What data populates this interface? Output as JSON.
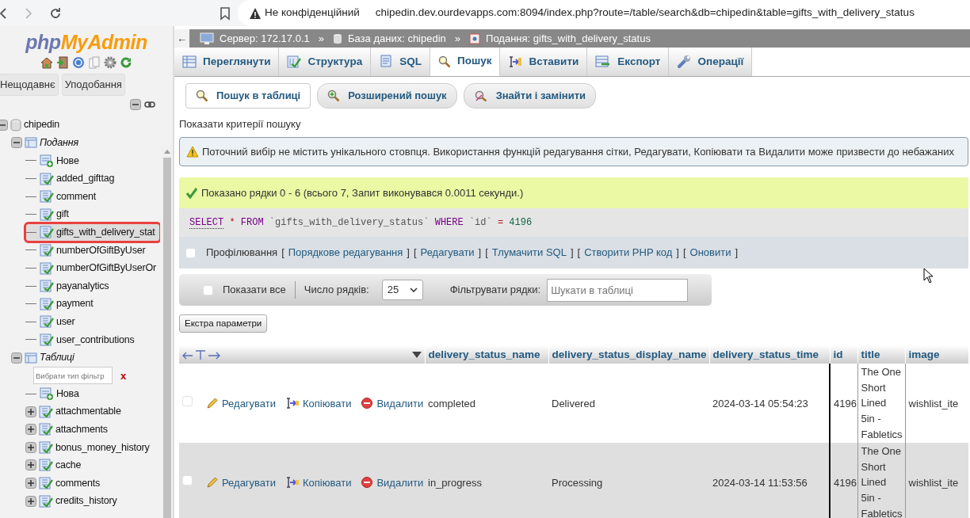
{
  "browser": {
    "warning": "Не конфіденційний",
    "url": "chipedin.dev.ourdevapps.com:8094/index.php?route=/table/search&db=chipedin&table=gifts_with_delivery_status"
  },
  "sidebar": {
    "logo": {
      "prefix": "php",
      "suffix": "MyAdmin"
    },
    "buttons": [
      "Нещодавнє",
      "Уподобання"
    ],
    "tree": [
      {
        "label": "chipedin",
        "kind": "database",
        "expanded": true,
        "children": [
          {
            "label": "Подання",
            "kind": "group",
            "expanded": true,
            "children": [
              {
                "label": "Нове",
                "kind": "new",
                "selected": false
              },
              {
                "label": "added_gifttag",
                "kind": "view",
                "selected": false
              },
              {
                "label": "comment",
                "kind": "view",
                "selected": false
              },
              {
                "label": "gift",
                "kind": "view",
                "selected": false
              },
              {
                "label": "gifts_with_delivery_stat",
                "kind": "view",
                "selected": true
              },
              {
                "label": "numberOfGiftByUser",
                "kind": "view",
                "selected": false
              },
              {
                "label": "numberOfGiftByUserOr",
                "kind": "view",
                "selected": false
              },
              {
                "label": "payanalytics",
                "kind": "view",
                "selected": false
              },
              {
                "label": "payment",
                "kind": "view",
                "selected": false
              },
              {
                "label": "user",
                "kind": "view",
                "selected": false
              },
              {
                "label": "user_contributions",
                "kind": "view",
                "selected": false
              }
            ]
          },
          {
            "label": "Таблиці",
            "kind": "group",
            "expanded": true,
            "filter": {
              "placeholder": "Вибрати тип фільтр",
              "clear": "x"
            },
            "children": [
              {
                "label": "Нова",
                "kind": "new",
                "selected": false
              },
              {
                "label": "attachmentable",
                "kind": "table",
                "expanded": false,
                "selected": false
              },
              {
                "label": "attachments",
                "kind": "table",
                "expanded": false,
                "selected": false
              },
              {
                "label": "bonus_money_history",
                "kind": "table",
                "expanded": false,
                "selected": false
              },
              {
                "label": "cache",
                "kind": "table",
                "expanded": false,
                "selected": false
              },
              {
                "label": "comments",
                "kind": "table",
                "expanded": false,
                "selected": false
              },
              {
                "label": "credits_history",
                "kind": "table",
                "expanded": false,
                "selected": false
              }
            ]
          }
        ]
      }
    ]
  },
  "breadcrumb": {
    "back": "←",
    "separator": "»",
    "items": [
      {
        "label": "Сервер: 172.17.0.1",
        "kind": "server"
      },
      {
        "label": "База даних: chipedin",
        "kind": "database"
      },
      {
        "label": "Подання: gifts_with_delivery_status",
        "kind": "view"
      }
    ]
  },
  "tabs": [
    {
      "label": "Переглянути",
      "kind": "browse",
      "selected": false
    },
    {
      "label": "Структура",
      "kind": "structure",
      "selected": false
    },
    {
      "label": "SQL",
      "kind": "sql",
      "selected": false
    },
    {
      "label": "Пошук",
      "kind": "search",
      "selected": true
    },
    {
      "label": "Вставити",
      "kind": "insert",
      "selected": false
    },
    {
      "label": "Експорт",
      "kind": "export",
      "selected": false
    },
    {
      "label": "Операції",
      "kind": "operations",
      "selected": false
    }
  ],
  "subtabs": [
    {
      "label": "Пошук в таблиці",
      "kind": "search",
      "selected": true
    },
    {
      "label": "Розширений пошук",
      "kind": "zoom",
      "selected": false
    },
    {
      "label": "Знайти і замінити",
      "kind": "replace",
      "selected": false
    }
  ],
  "criteria_link": "Показати критерії пошуку",
  "warning": "Поточний вибір не містить унікального стовпця. Використання функцій редагування сітки, Редагувати, Копіювати та Видалити може призвести до небажаних",
  "success": "Показано рядки 0 - 6 (всього 7, Запит виконувався 0.0011 секунди.)",
  "sql": [
    {
      "text": "SELECT",
      "kind": "keyword"
    },
    {
      "text": "*",
      "kind": "operator"
    },
    {
      "text": "FROM",
      "kind": "keyword"
    },
    {
      "text": "`gifts_with_delivery_status`",
      "kind": "identifier"
    },
    {
      "text": "WHERE",
      "kind": "keyword"
    },
    {
      "text": "`id`",
      "kind": "identifier"
    },
    {
      "text": "=",
      "kind": "operator"
    },
    {
      "text": "4196",
      "kind": "number"
    }
  ],
  "profiling": {
    "label": "Профілювання",
    "checked": false,
    "links": [
      {
        "open": "[",
        "label": "Порядкове редагування",
        "close": "]"
      },
      {
        "open": "[",
        "label": "Редагувати",
        "close": "]"
      },
      {
        "open": "[",
        "label": "Тлумачити SQL",
        "close": "]"
      },
      {
        "open": "[",
        "label": "Створити PHP код",
        "close": "]"
      },
      {
        "open": "[",
        "label": "Оновити",
        "close": "]"
      }
    ]
  },
  "navigation": {
    "show_all": {
      "label": "Показати все",
      "checked": false
    },
    "rows_label": "Число рядків:",
    "rows_value": "25",
    "filter_label": "Фільтрувати рядки:",
    "filter_placeholder": "Шукати в таблиці"
  },
  "extra_button": "Екстра параметри",
  "table": {
    "columns": [
      "delivery_status_name",
      "delivery_status_display_name",
      "delivery_status_time",
      "id",
      "title",
      "image"
    ],
    "rows": [
      {
        "checked": false,
        "actions": [
          {
            "label": "Редагувати",
            "kind": "edit"
          },
          {
            "label": "Копіювати",
            "kind": "copy"
          },
          {
            "label": "Видалити",
            "kind": "delete"
          }
        ],
        "cells": [
          "completed",
          "Delivered",
          "2024-03-14 05:54:23",
          "4196",
          "The One Short Lined 5in - Fabletics",
          "wishlist_ite"
        ]
      },
      {
        "checked": false,
        "actions": [
          {
            "label": "Редагувати",
            "kind": "edit"
          },
          {
            "label": "Копіювати",
            "kind": "copy"
          },
          {
            "label": "Видалити",
            "kind": "delete"
          }
        ],
        "cells": [
          "in_progress",
          "Processing",
          "2024-03-14 11:53:56",
          "4196",
          "The One Short Lined 5in - Fabletics",
          "wishlist_ite"
        ]
      }
    ]
  }
}
